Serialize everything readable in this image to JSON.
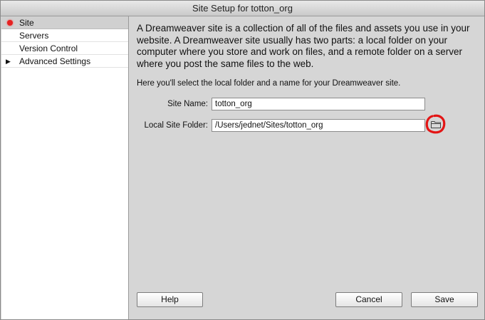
{
  "window": {
    "title": "Site Setup for totton_org"
  },
  "sidebar": {
    "items": [
      {
        "label": "Site",
        "selected": true
      },
      {
        "label": "Servers"
      },
      {
        "label": "Version Control"
      },
      {
        "label": "Advanced Settings",
        "expandable": true
      }
    ]
  },
  "main": {
    "intro": "A Dreamweaver site is a collection of all of the files and assets you use in your website. A Dreamweaver site usually has two parts: a local folder on your computer where you store and work on files, and a remote folder on a server where you post the same files to the web.",
    "hint": "Here you'll select the local folder and a name for your Dreamweaver site.",
    "site_name": {
      "label": "Site Name:",
      "value": "totton_org"
    },
    "local_folder": {
      "label": "Local Site Folder:",
      "value": "/Users/jednet/Sites/totton_org"
    }
  },
  "buttons": {
    "help": "Help",
    "cancel": "Cancel",
    "save": "Save"
  },
  "colors": {
    "annotation": "#e31515",
    "selected_dot": "#e52222"
  },
  "icons": {
    "browse": "folder-icon"
  }
}
